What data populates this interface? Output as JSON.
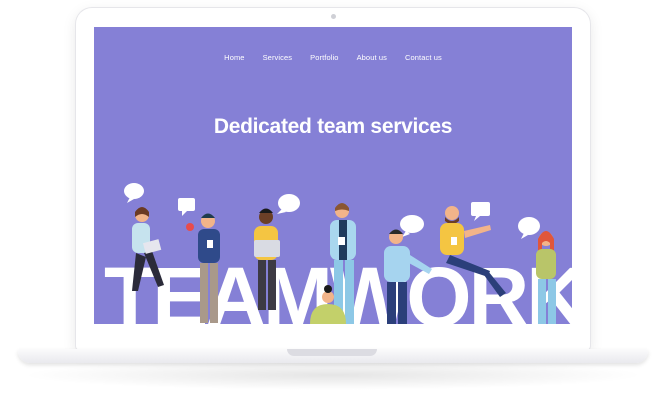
{
  "nav": {
    "items": [
      {
        "label": "Home"
      },
      {
        "label": "Services"
      },
      {
        "label": "Portfolio"
      },
      {
        "label": "About us"
      },
      {
        "label": "Contact us"
      }
    ]
  },
  "hero": {
    "title": "Dedicated team services",
    "big_word": "TEAMWORK"
  },
  "colors": {
    "screen_bg": "#8580d6",
    "text": "#ffffff"
  },
  "illustration": {
    "icon": "people-illustration-icon"
  }
}
